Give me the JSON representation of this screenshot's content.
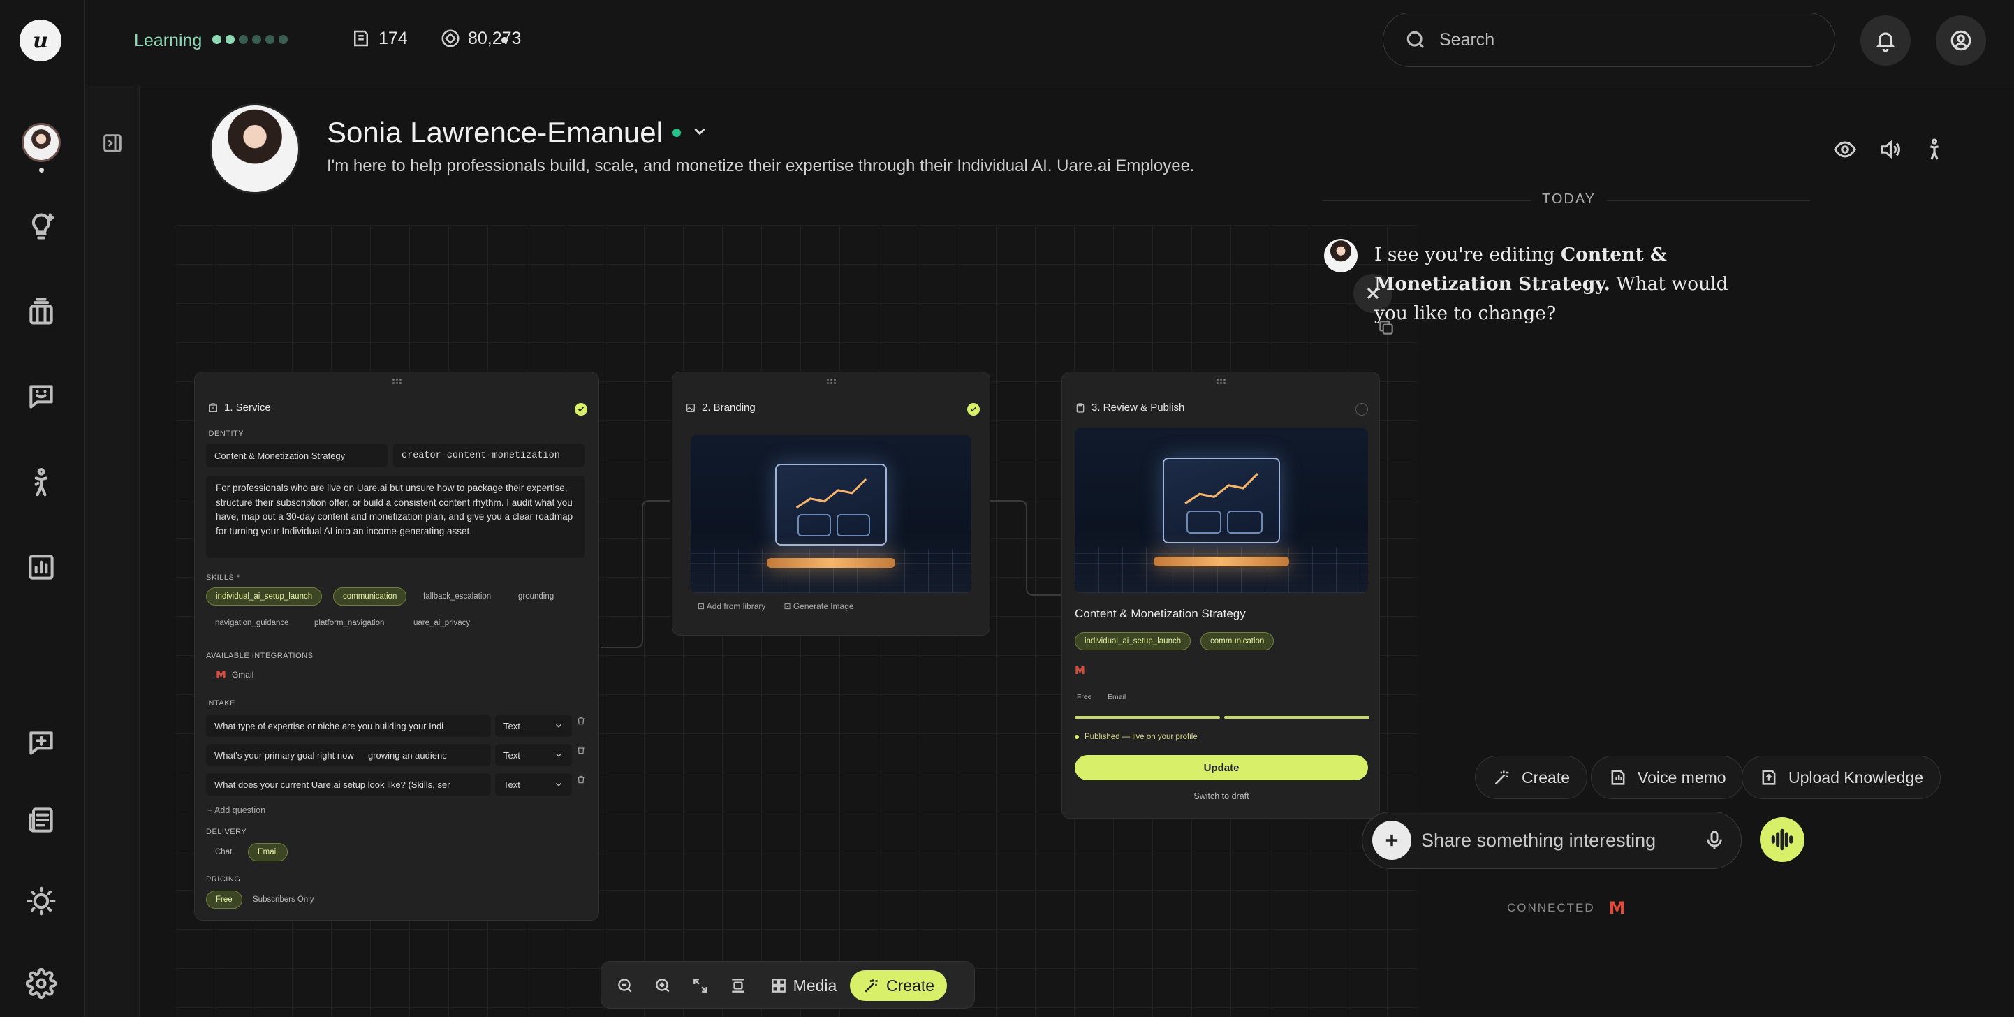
{
  "topbar": {
    "learning_label": "Learning",
    "level_dots_on": 2,
    "level_dots_total": 6,
    "stat_one": "174",
    "stat_two": "80,273",
    "search_placeholder": "Search",
    "accent": "#8fd9b6"
  },
  "rail": {
    "icons": [
      "lightbulb-plus-icon",
      "briefcase-stack-icon",
      "chat-smile-icon",
      "accessibility-figure-icon",
      "bar-chart-icon",
      "chat-plus-icon",
      "newspaper-icon",
      "sun-icon",
      "gear-icon"
    ]
  },
  "profile": {
    "name": "Sonia Lawrence-Emanuel",
    "bio": "I'm here to help professionals build, scale, and monetize their expertise through their Individual AI. Uare.ai Employee.",
    "status_color": "#24c28a"
  },
  "service_card": {
    "title": "1. Service",
    "identity_label": "IDENTITY",
    "service_name": "Content & Monetization Strategy",
    "slug": "creator-content-monetization",
    "description": "For professionals who are live on Uare.ai but unsure how to package their expertise, structure their subscription offer, or build a consistent content rhythm. I audit what you have, map out a 30-day content and monetization plan, and give you a clear roadmap for turning your Individual AI into an income-generating asset.",
    "skills_label": "SKILLS *",
    "skills": [
      {
        "label": "individual_ai_setup_launch",
        "active": true
      },
      {
        "label": "communication",
        "active": true
      },
      {
        "label": "fallback_escalation",
        "active": false
      },
      {
        "label": "grounding",
        "active": false
      },
      {
        "label": "navigation_guidance",
        "active": false
      },
      {
        "label": "platform_navigation",
        "active": false
      },
      {
        "label": "uare_ai_privacy",
        "active": false
      }
    ],
    "integrations_label": "AVAILABLE INTEGRATIONS",
    "integration": "Gmail",
    "intake_label": "INTAKE",
    "intake": [
      {
        "question": "What type of expertise or niche are you building your Indi",
        "type": "Text"
      },
      {
        "question": "What's your primary goal right now — growing an audienc",
        "type": "Text"
      },
      {
        "question": "What does your current Uare.ai setup look like? (Skills, ser",
        "type": "Text"
      }
    ],
    "add_question": "+ Add question",
    "delivery_label": "DELIVERY",
    "delivery": [
      {
        "label": "Chat",
        "active": false
      },
      {
        "label": "Email",
        "active": true
      }
    ],
    "pricing_label": "PRICING",
    "pricing": [
      {
        "label": "Free",
        "active": true
      },
      {
        "label": "Subscribers Only",
        "active": false
      }
    ]
  },
  "branding_card": {
    "title": "2. Branding",
    "add_from_library": "Add from library",
    "generate_image": "Generate Image"
  },
  "review_card": {
    "title": "3. Review & Publish",
    "service_name": "Content & Monetization Strategy",
    "skills": [
      "individual_ai_setup_launch",
      "communication"
    ],
    "tags": [
      "Free",
      "Email"
    ],
    "status": "Published — live on your profile",
    "update_label": "Update",
    "switch_label": "Switch to draft"
  },
  "toolbar": {
    "media_label": "Media",
    "create_label": "Create"
  },
  "chat": {
    "day_label": "TODAY",
    "msg_prefix": "I see you're editing ",
    "msg_bold": "Content & Monetization Strategy.",
    "msg_suffix": " What would you like to change?",
    "actions": [
      "Create",
      "Voice memo",
      "Upload Knowledge"
    ],
    "composer_placeholder": "Share something interesting",
    "connected_label": "CONNECTED"
  },
  "colors": {
    "accent_lime": "#d8ef6a",
    "background": "#141414",
    "card": "#222222"
  }
}
